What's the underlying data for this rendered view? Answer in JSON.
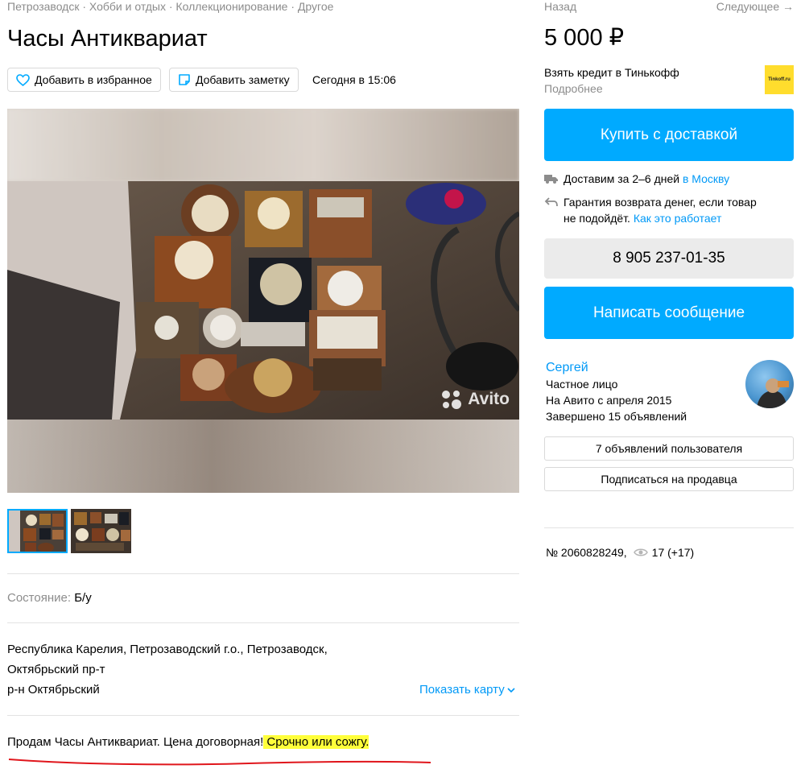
{
  "breadcrumbs": "Петрозаводск · Хобби и отдых · Коллекционирование · Другое",
  "title": "Часы Антиквариат",
  "actions": {
    "favorite_label": "Добавить в избранное",
    "note_label": "Добавить заметку",
    "date": "Сегодня в 15:06"
  },
  "gallery": {
    "watermark": "Avito",
    "thumb_count": 2
  },
  "params": {
    "condition_label": "Состояние:",
    "condition_value": "Б/у"
  },
  "address": {
    "line1": "Республика Карелия, Петрозаводский г.о., Петрозаводск,",
    "line2": "Октябрьский пр-т",
    "district": "р-н Октябрьский",
    "map_link": "Показать карту"
  },
  "description": {
    "text": "Продам Часы Антиквариат. Цена договорная!",
    "highlighted": " Срочно или сожгу."
  },
  "nav": {
    "back": "Назад",
    "next": "Следующее →"
  },
  "price": "5 000 ₽",
  "credit": {
    "title": "Взять кредит в Тинькофф",
    "more": "Подробнее",
    "logo_text": "Tinkoff.ru"
  },
  "buy_button": "Купить с доставкой",
  "delivery": {
    "text": "Доставим за 2–6 дней",
    "link": "в Москву"
  },
  "guarantee": {
    "line1": "Гарантия возврата денег, если товар",
    "line2": "не подойдёт.",
    "link": "Как это работает"
  },
  "phone": "8 905 237-01-35",
  "message_button": "Написать сообщение",
  "seller": {
    "name": "Сергей",
    "type": "Частное лицо",
    "since": "На Авито с апреля 2015",
    "completed": "Завершено 15 объявлений",
    "ads_button": "7 объявлений пользователя",
    "subscribe_button": "Подписаться на продавца"
  },
  "item": {
    "number": "№ 2060828249,",
    "views": "17 (+17)"
  },
  "colors": {
    "accent": "#00aaff",
    "link": "#0099f7",
    "highlight": "#ffff3a",
    "underline": "#e0161c",
    "tinkoff": "#ffdd2d"
  }
}
